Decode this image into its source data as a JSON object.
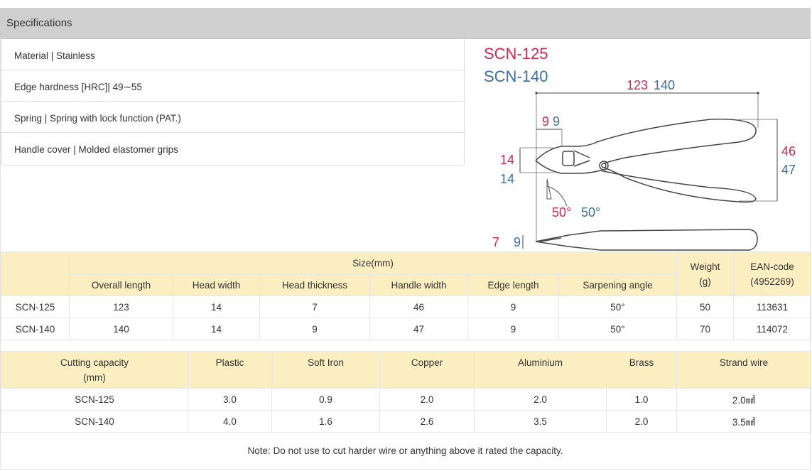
{
  "header": {
    "title": "Specifications"
  },
  "specs": [
    "Material | Stainless",
    "Edge hardness [HRC]| 49∼55",
    "Spring | Spring with lock function (PAT.)",
    "Handle cover | Molded elastomer grips"
  ],
  "diagram": {
    "model_a": "SCN-125",
    "model_b": "SCN-140",
    "color_a": "#d8254f",
    "color_b": "#3a6ea5",
    "length_a": "123",
    "length_b": "140",
    "edge_a": "9",
    "edge_b": "9",
    "headwidth_a": "14",
    "headwidth_b": "14",
    "handle_a": "46",
    "handle_b": "47",
    "angle_a": "50°",
    "angle_b": "50°",
    "thick_a": "7",
    "thick_b": "9"
  },
  "size_table": {
    "group_header": "Size(mm)",
    "weight_header": "Weight\n(g)",
    "ean_header": "EAN-code\n(4952269)",
    "columns": [
      "Overall length",
      "Head width",
      "Head thickness",
      "Handle width",
      "Edge length",
      "Sarpening angle"
    ],
    "rows": [
      {
        "model": "SCN-125",
        "values": [
          "123",
          "14",
          "7",
          "46",
          "9",
          "50°"
        ],
        "weight": "50",
        "ean": "113631"
      },
      {
        "model": "SCN-140",
        "values": [
          "140",
          "14",
          "9",
          "47",
          "9",
          "50°"
        ],
        "weight": "70",
        "ean": "114072"
      }
    ]
  },
  "capacity_table": {
    "header_first": "Cutting capacity\n(mm)",
    "columns": [
      "Plastic",
      "Soft Iron",
      "Copper",
      "Aluminium",
      "Brass",
      "Strand wire"
    ],
    "rows": [
      {
        "model": "SCN-125",
        "values": [
          "3.0",
          "0.9",
          "2.0",
          "2.0",
          "1.0",
          "2.0㎟"
        ]
      },
      {
        "model": "SCN-140",
        "values": [
          "4.0",
          "1.6",
          "2.6",
          "3.5",
          "2.0",
          "3.5㎟"
        ]
      }
    ]
  },
  "note": "Note: Do not use to cut harder wire or anything above it rated the capacity."
}
